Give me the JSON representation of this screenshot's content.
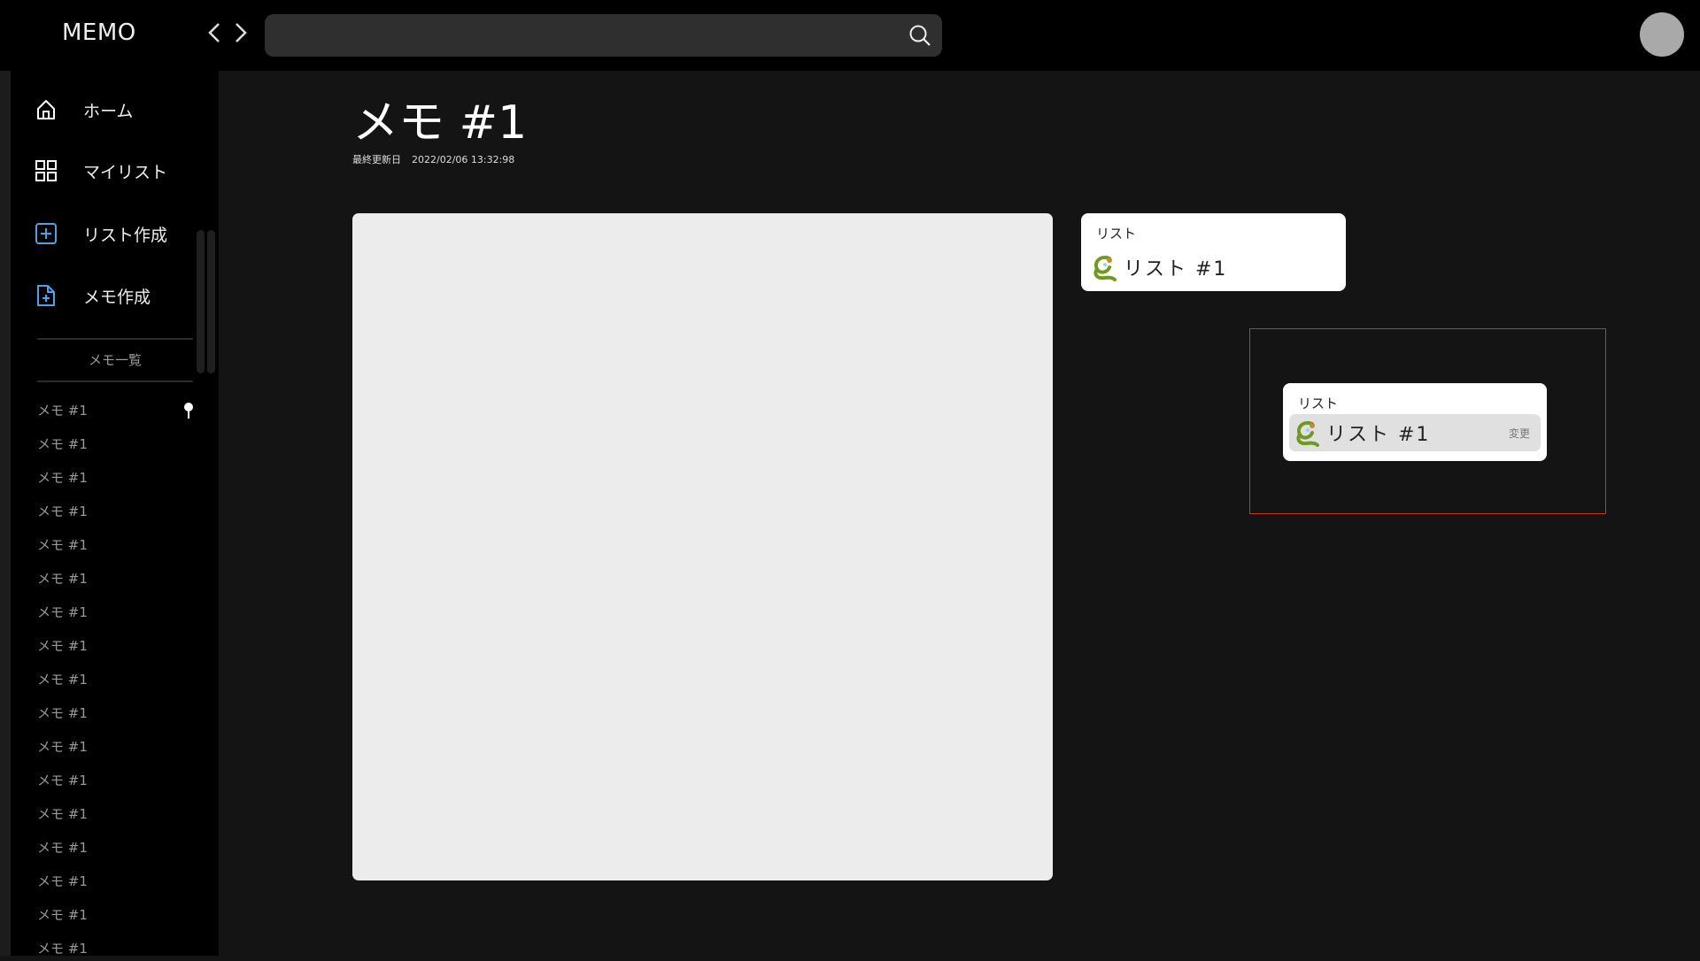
{
  "header": {
    "logo": "MEMO",
    "search_placeholder": ""
  },
  "sidebar": {
    "nav": [
      {
        "label": "ホーム",
        "icon": "home-icon"
      },
      {
        "label": "マイリスト",
        "icon": "grid-icon"
      },
      {
        "label": "リスト作成",
        "icon": "plus-square-icon"
      },
      {
        "label": "メモ作成",
        "icon": "file-plus-icon"
      }
    ],
    "section_title": "メモ一覧",
    "memos": [
      "メモ #1",
      "メモ #1",
      "メモ #1",
      "メモ #1",
      "メモ #1",
      "メモ #1",
      "メモ #1",
      "メモ #1",
      "メモ #1",
      "メモ #1",
      "メモ #1",
      "メモ #1",
      "メモ #1",
      "メモ #1",
      "メモ #1",
      "メモ #1",
      "メモ #1"
    ]
  },
  "main": {
    "title": "メモ #1",
    "updated_label": "最終更新日",
    "updated_value": "2022/02/06 13:32:98",
    "list_card": {
      "label": "リスト",
      "name": "リスト #1"
    },
    "list_card_edit": {
      "label": "リスト",
      "name": "リスト #1",
      "change": "変更"
    }
  },
  "colors": {
    "accent": "#4ea3e8",
    "highlight": "#c8361f"
  }
}
